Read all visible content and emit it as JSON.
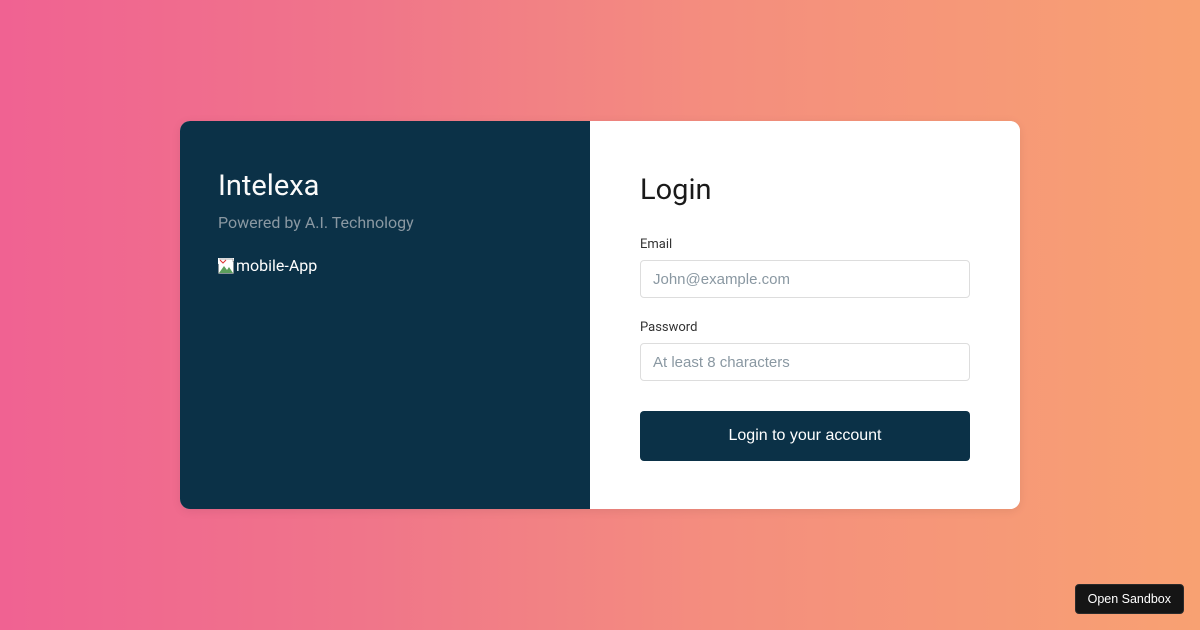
{
  "brand": {
    "title": "Intelexa",
    "tagline": "Powered by A.I. Technology",
    "image_alt": "mobile-App"
  },
  "login": {
    "heading": "Login",
    "email_label": "Email",
    "email_placeholder": "John@example.com",
    "password_label": "Password",
    "password_placeholder": "At least 8 characters",
    "submit_label": "Login to your account"
  },
  "sandbox": {
    "open_label": "Open Sandbox"
  }
}
